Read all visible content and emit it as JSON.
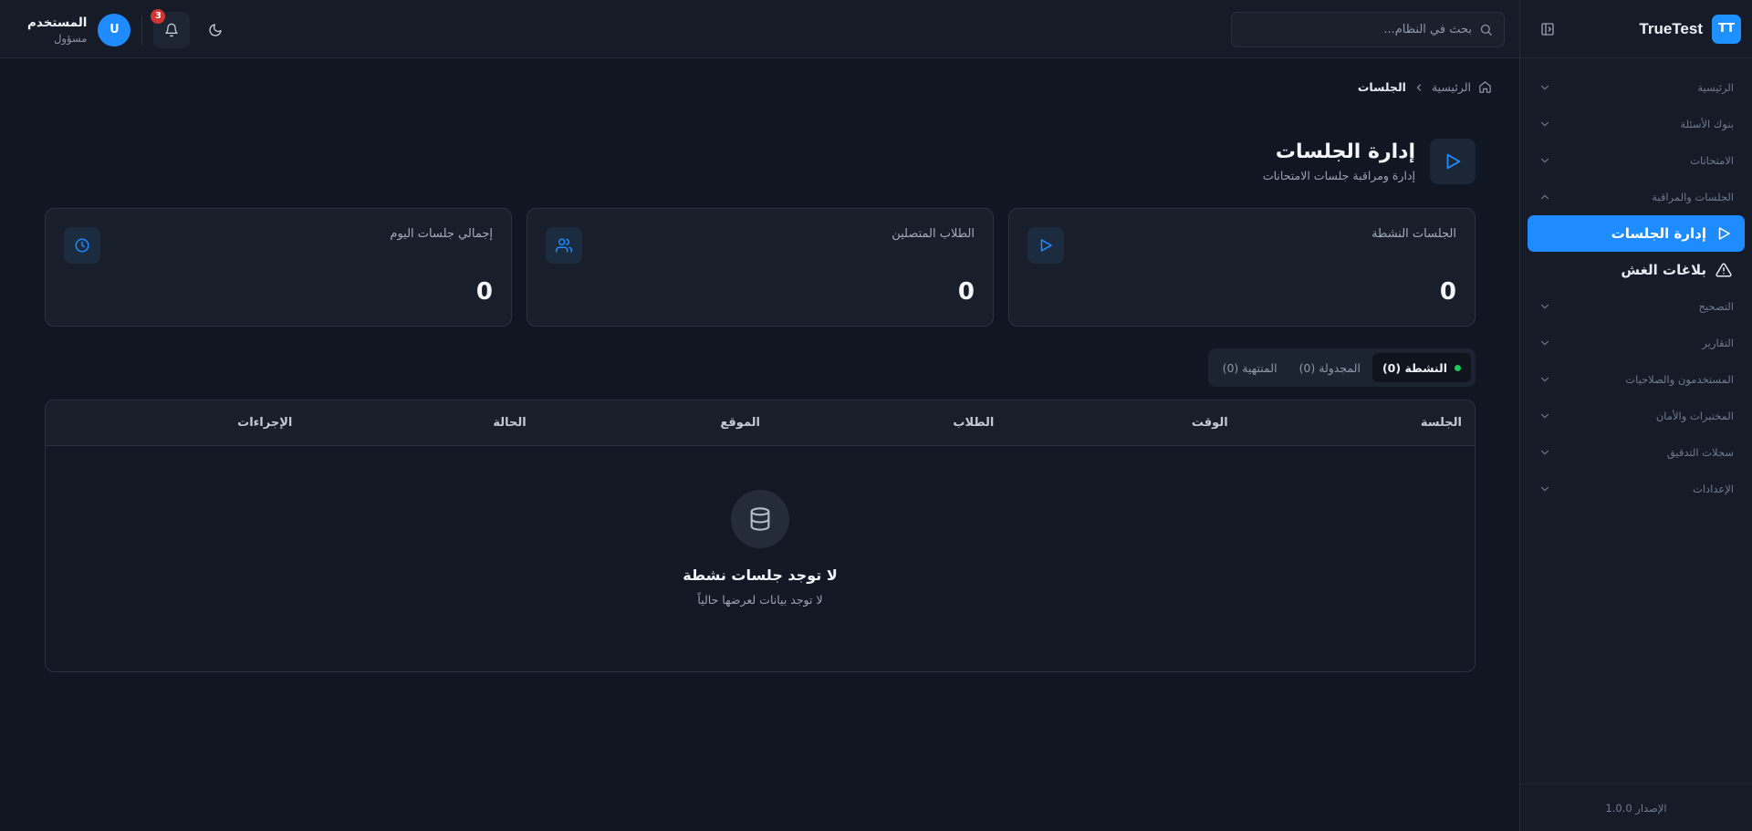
{
  "brand": {
    "logo": "TT",
    "name": "TrueTest"
  },
  "search": {
    "placeholder": "بحث في النظام..."
  },
  "user": {
    "initial": "U",
    "name": "المستخدم",
    "role": "مسؤول"
  },
  "notifications": {
    "count": "3"
  },
  "sidebar": {
    "groups_top": [
      {
        "label": "الرئيسية",
        "icon": "chevron-down-icon"
      },
      {
        "label": "بنوك الأسئلة",
        "icon": "chevron-down-icon"
      },
      {
        "label": "الامتحانات",
        "icon": "chevron-down-icon"
      },
      {
        "label": "الجلسات والمراقبة",
        "icon": "chevron-up-icon"
      }
    ],
    "sub_items": [
      {
        "label": "إدارة الجلسات",
        "icon": "play-icon",
        "active": true
      },
      {
        "label": "بلاغات الغش",
        "icon": "warning-icon",
        "active": false
      }
    ],
    "groups_bottom": [
      {
        "label": "التصحيح",
        "icon": "chevron-down-icon"
      },
      {
        "label": "التقارير",
        "icon": "chevron-down-icon"
      },
      {
        "label": "المستخدمون والصلاحيات",
        "icon": "chevron-down-icon"
      },
      {
        "label": "المختبرات والأمان",
        "icon": "chevron-down-icon"
      },
      {
        "label": "سجلات التدقيق",
        "icon": "chevron-down-icon"
      },
      {
        "label": "الإعدادات",
        "icon": "chevron-down-icon"
      }
    ],
    "version": "الإصدار 1.0.0"
  },
  "breadcrumb": {
    "home": "الرئيسية",
    "current": "الجلسات"
  },
  "page": {
    "title": "إدارة الجلسات",
    "subtitle": "إدارة ومراقبة جلسات الامتحانات"
  },
  "stats": [
    {
      "label": "الجلسات النشطة",
      "value": "0",
      "icon": "play-icon"
    },
    {
      "label": "الطلاب المتصلين",
      "value": "0",
      "icon": "users-icon"
    },
    {
      "label": "إجمالي جلسات اليوم",
      "value": "0",
      "icon": "clock-icon"
    }
  ],
  "tabs": [
    {
      "label": "النشطة (0)",
      "active": true
    },
    {
      "label": "المجدولة (0)",
      "active": false
    },
    {
      "label": "المنتهية (0)",
      "active": false
    }
  ],
  "table": {
    "columns": [
      "الجلسة",
      "الوقت",
      "الطلاب",
      "الموقع",
      "الحالة",
      "الإجراءات"
    ],
    "empty_title": "لا توجد جلسات نشطة",
    "empty_sub": "لا توجد بيانات لعرضها حالياً"
  },
  "colors": {
    "accent": "#1e8cff",
    "background": "#111722",
    "panel": "#151c27",
    "badge": "#d23434",
    "active_dot": "#22c55e"
  }
}
